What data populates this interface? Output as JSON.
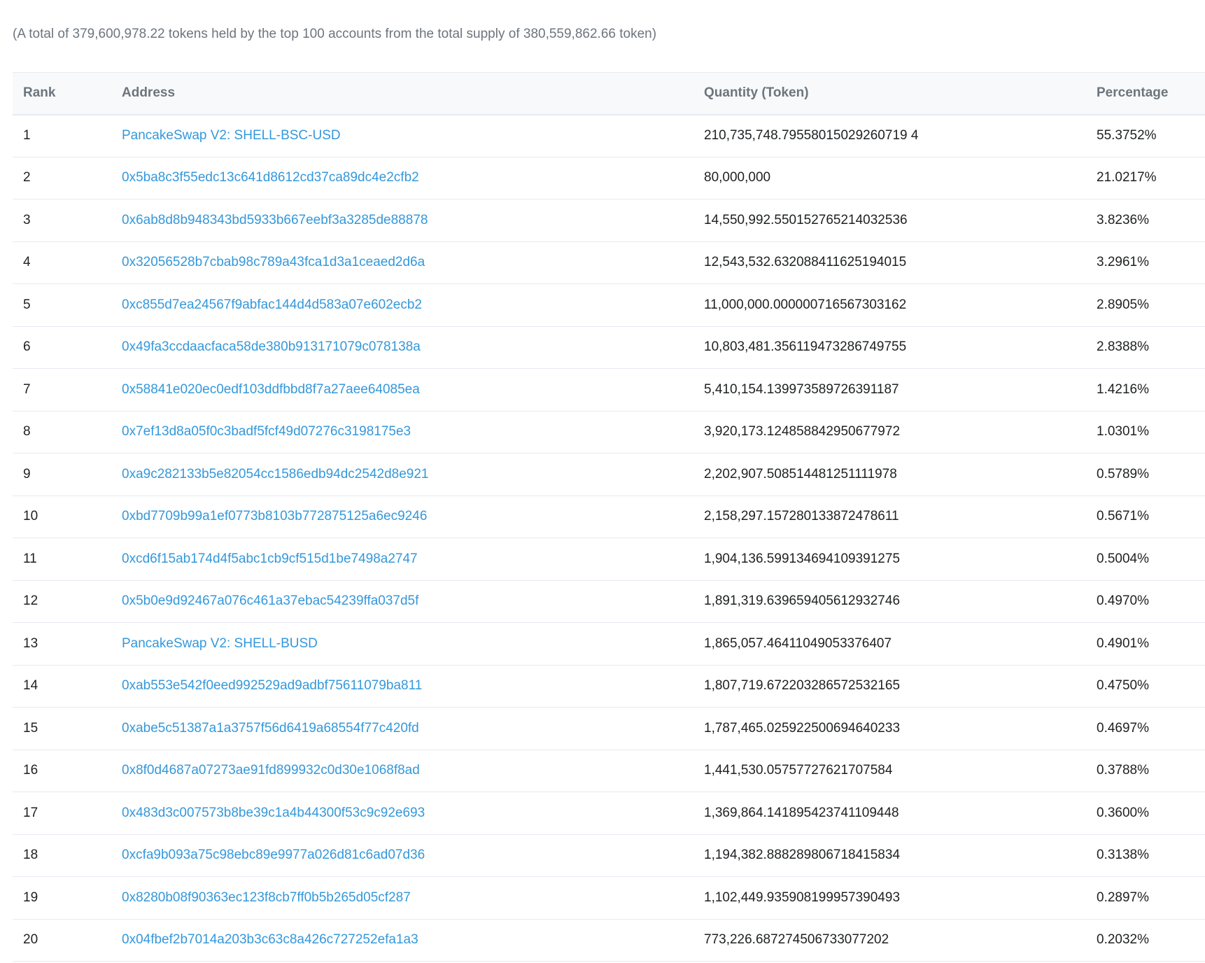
{
  "summary": "(A total of 379,600,978.22 tokens held by the top 100 accounts from the total supply of 380,559,862.66 token)",
  "table": {
    "headers": {
      "rank": "Rank",
      "address": "Address",
      "quantity": "Quantity (Token)",
      "percentage": "Percentage"
    },
    "rows": [
      {
        "rank": "1",
        "address": "PancakeSwap V2: SHELL-BSC-USD",
        "quantity": "210,735,748.79558015029260719 4",
        "percentage": "55.3752%"
      },
      {
        "rank": "2",
        "address": "0x5ba8c3f55edc13c641d8612cd37ca89dc4e2cfb2",
        "quantity": "80,000,000",
        "percentage": "21.0217%"
      },
      {
        "rank": "3",
        "address": "0x6ab8d8b948343bd5933b667eebf3a3285de88878",
        "quantity": "14,550,992.550152765214032536",
        "percentage": "3.8236%"
      },
      {
        "rank": "4",
        "address": "0x32056528b7cbab98c789a43fca1d3a1ceaed2d6a",
        "quantity": "12,543,532.632088411625194015",
        "percentage": "3.2961%"
      },
      {
        "rank": "5",
        "address": "0xc855d7ea24567f9abfac144d4d583a07e602ecb2",
        "quantity": "11,000,000.000000716567303162",
        "percentage": "2.8905%"
      },
      {
        "rank": "6",
        "address": "0x49fa3ccdaacfaca58de380b913171079c078138a",
        "quantity": "10,803,481.356119473286749755",
        "percentage": "2.8388%"
      },
      {
        "rank": "7",
        "address": "0x58841e020ec0edf103ddfbbd8f7a27aee64085ea",
        "quantity": "5,410,154.139973589726391187",
        "percentage": "1.4216%"
      },
      {
        "rank": "8",
        "address": "0x7ef13d8a05f0c3badf5fcf49d07276c3198175e3",
        "quantity": "3,920,173.124858842950677972",
        "percentage": "1.0301%"
      },
      {
        "rank": "9",
        "address": "0xa9c282133b5e82054cc1586edb94dc2542d8e921",
        "quantity": "2,202,907.508514481251111978",
        "percentage": "0.5789%"
      },
      {
        "rank": "10",
        "address": "0xbd7709b99a1ef0773b8103b772875125a6ec9246",
        "quantity": "2,158,297.157280133872478611",
        "percentage": "0.5671%"
      },
      {
        "rank": "11",
        "address": "0xcd6f15ab174d4f5abc1cb9cf515d1be7498a2747",
        "quantity": "1,904,136.599134694109391275",
        "percentage": "0.5004%"
      },
      {
        "rank": "12",
        "address": "0x5b0e9d92467a076c461a37ebac54239ffa037d5f",
        "quantity": "1,891,319.639659405612932746",
        "percentage": "0.4970%"
      },
      {
        "rank": "13",
        "address": "PancakeSwap V2: SHELL-BUSD",
        "quantity": "1,865,057.46411049053376407",
        "percentage": "0.4901%"
      },
      {
        "rank": "14",
        "address": "0xab553e542f0eed992529ad9adbf75611079ba811",
        "quantity": "1,807,719.672203286572532165",
        "percentage": "0.4750%"
      },
      {
        "rank": "15",
        "address": "0xabe5c51387a1a3757f56d6419a68554f77c420fd",
        "quantity": "1,787,465.025922500694640233",
        "percentage": "0.4697%"
      },
      {
        "rank": "16",
        "address": "0x8f0d4687a07273ae91fd899932c0d30e1068f8ad",
        "quantity": "1,441,530.05757727621707584",
        "percentage": "0.3788%"
      },
      {
        "rank": "17",
        "address": "0x483d3c007573b8be39c1a4b44300f53c9c92e693",
        "quantity": "1,369,864.141895423741109448",
        "percentage": "0.3600%"
      },
      {
        "rank": "18",
        "address": "0xcfa9b093a75c98ebc89e9977a026d81c6ad07d36",
        "quantity": "1,194,382.888289806718415834",
        "percentage": "0.3138%"
      },
      {
        "rank": "19",
        "address": "0x8280b08f90363ec123f8cb7ff0b5b265d05cf287",
        "quantity": "1,102,449.935908199957390493",
        "percentage": "0.2897%"
      },
      {
        "rank": "20",
        "address": "0x04fbef2b7014a203b3c63c8a426c727252efa1a3",
        "quantity": "773,226.687274506733077202",
        "percentage": "0.2032%"
      }
    ]
  }
}
